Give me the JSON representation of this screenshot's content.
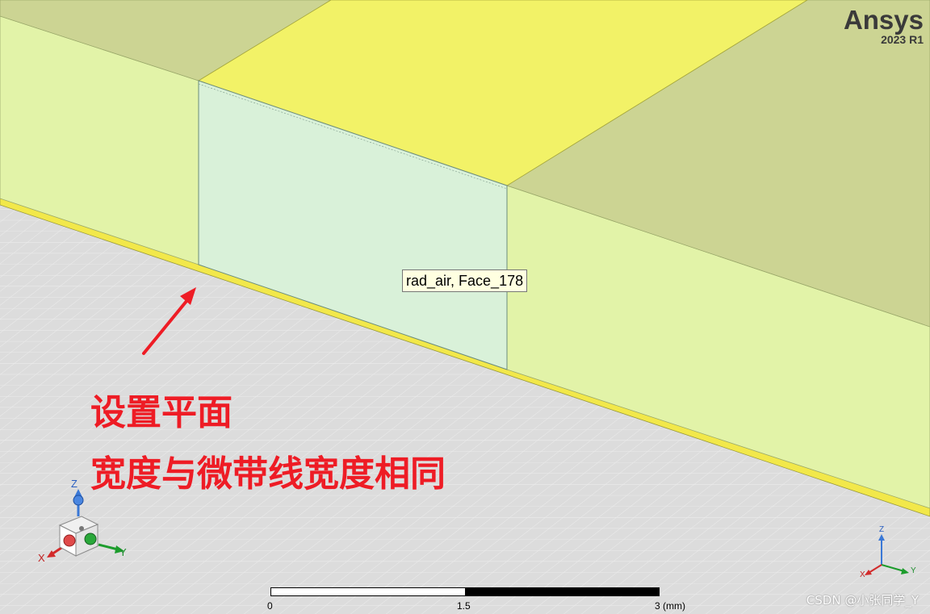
{
  "brand": {
    "name": "Ansys",
    "version": "2023 R1"
  },
  "tooltip": {
    "text": "rad_air, Face_178"
  },
  "annotation": {
    "line1": "设置平面",
    "line2": "宽度与微带线宽度相同",
    "color": "#ee1c25"
  },
  "scale_bar": {
    "labels": [
      "0",
      "1.5",
      "3 (mm)"
    ]
  },
  "triad": {
    "axes": [
      "X",
      "Y",
      "Z"
    ]
  },
  "mini_triad": {
    "axes": [
      "X",
      "Y",
      "Z"
    ]
  },
  "watermark": {
    "text": "CSDN @小张同学_Y"
  },
  "colors": {
    "grid_background": "#dcdcdc",
    "grid_line": "#eeeeee",
    "ground_plane_edge": "#f2e84a",
    "side_face_light": "#e2f3a8",
    "top_face_olive": "#ccd493",
    "microstrip_top": "#f2f267",
    "selected_face": "#d9f1d9"
  }
}
